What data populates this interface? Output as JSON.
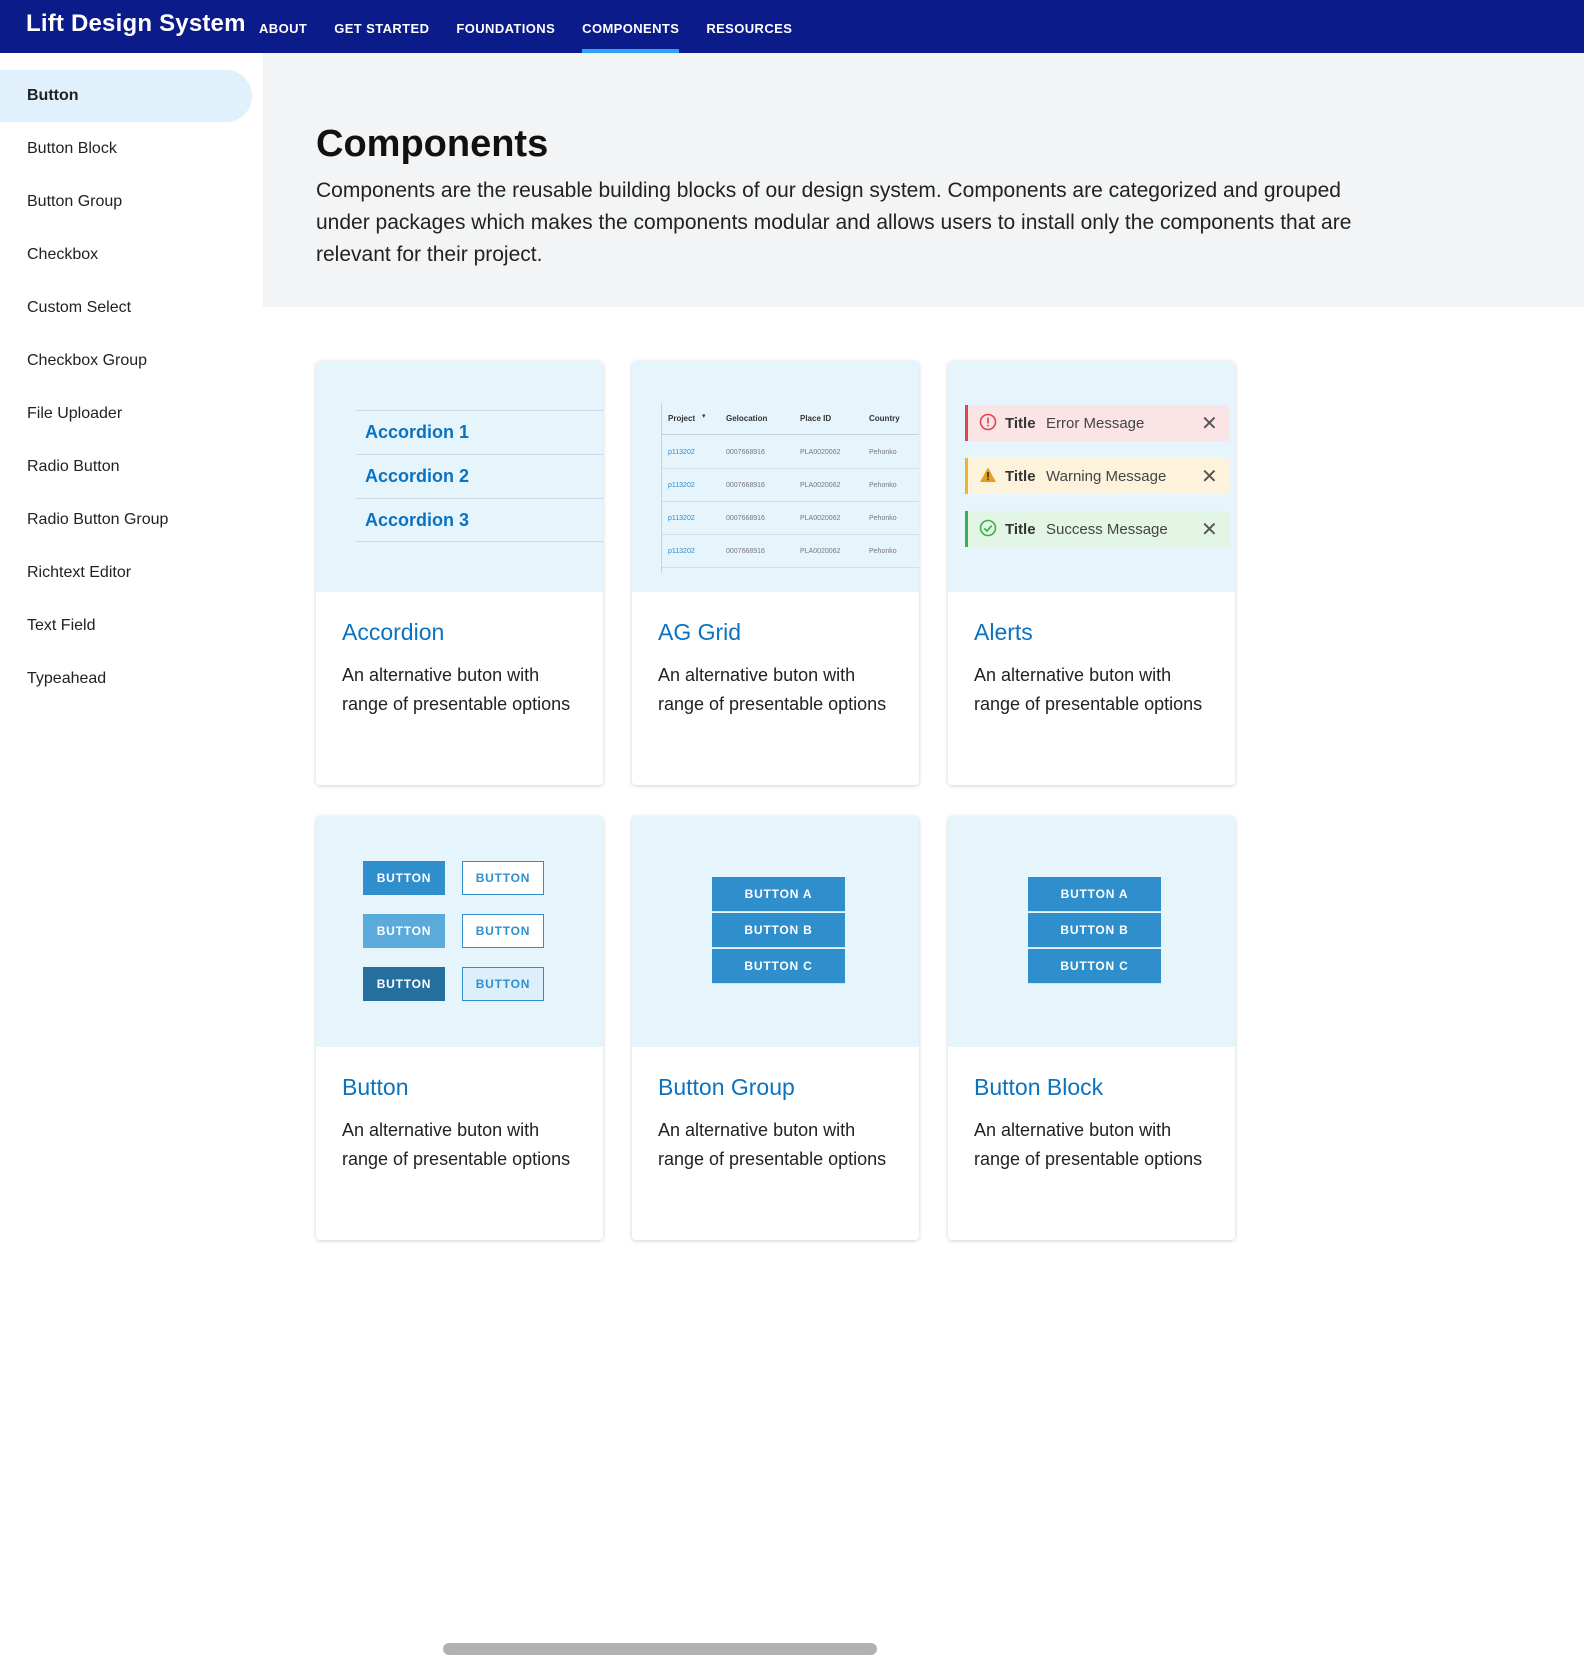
{
  "brand": "Lift Design System",
  "nav": [
    "ABOUT",
    "GET STARTED",
    "FOUNDATIONS",
    "COMPONENTS",
    "RESOURCES"
  ],
  "nav_active": "COMPONENTS",
  "sidebar": {
    "items": [
      "Button",
      "Button Block",
      "Button Group",
      "Checkbox",
      "Custom Select",
      "Checkbox Group",
      "File Uploader",
      "Radio Button",
      "Radio Button Group",
      "Richtext Editor",
      "Text Field",
      "Typeahead"
    ],
    "active": "Button"
  },
  "hero": {
    "title": "Components",
    "description": "Components are the reusable building blocks of our design system. Components are categorized and grouped under packages which makes the components modular and allows users to install only the components that are relevant for their project."
  },
  "cards": [
    {
      "title": "Accordion",
      "desc": "An alternative buton with range of presentable options"
    },
    {
      "title": "AG Grid",
      "desc": "An alternative buton with range of presentable options"
    },
    {
      "title": "Alerts",
      "desc": "An alternative buton with range of presentable options"
    },
    {
      "title": "Button",
      "desc": "An alternative buton with range of presentable options"
    },
    {
      "title": "Button Group",
      "desc": "An alternative buton with range of presentable options"
    },
    {
      "title": "Button Block",
      "desc": "An alternative buton with range of presentable options"
    }
  ],
  "accordion_preview": [
    "Accordion 1",
    "Accordion 2",
    "Accordion 3"
  ],
  "grid_preview": {
    "headers": [
      "Project",
      "Gelocation",
      "Place ID",
      "Country"
    ],
    "rows": [
      [
        "p113202",
        "0007668916",
        "PLA0020062",
        "Pehonko"
      ],
      [
        "p113202",
        "0007668916",
        "PLA0020062",
        "Pehonko"
      ],
      [
        "p113202",
        "0007668916",
        "PLA0020062",
        "Pehonko"
      ],
      [
        "p113202",
        "0007668916",
        "PLA0020062",
        "Pehonko"
      ]
    ]
  },
  "alerts_preview": [
    {
      "title": "Title",
      "message": "Error Message",
      "type": "error",
      "color": "#e0444e",
      "bg": "#fbe4e6"
    },
    {
      "title": "Title",
      "message": "Warning Message",
      "type": "warning",
      "color": "#f0b429",
      "bg": "#fdf3dc"
    },
    {
      "title": "Title",
      "message": "Success Message",
      "type": "success",
      "color": "#3cae4a",
      "bg": "#e3f5e4"
    }
  ],
  "button_preview_label": "BUTTON",
  "group_preview": [
    "BUTTON A",
    "BUTTON B",
    "BUTTON C"
  ],
  "block_preview": [
    "BUTTON A",
    "BUTTON B",
    "BUTTON C"
  ],
  "colors": {
    "nav_bg": "#0b1b8a",
    "nav_indicator": "#2ea3f2",
    "link_blue": "#0b72c0",
    "button_blue": "#2f8fcc",
    "preview_bg": "#e6f4fb"
  }
}
